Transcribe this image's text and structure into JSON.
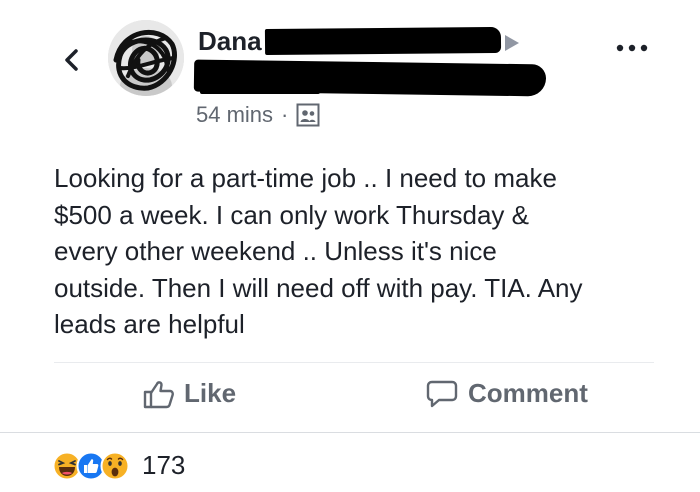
{
  "post": {
    "author_name_visible": "Dana",
    "timestamp": "54 mins",
    "separator": "·",
    "audience_icon": "friends-group-icon",
    "body": "Looking for a part-time job .. I need to make\n$500 a week. I can only work Thursday &\nevery other weekend .. Unless it's nice\noutside. Then I will need off with pay. TIA. Any\nleads are helpful"
  },
  "header": {
    "back_icon": "chevron-left-icon",
    "more_icon": "more-dots-icon"
  },
  "actions": {
    "like_label": "Like",
    "comment_label": "Comment"
  },
  "reactions": {
    "icons": [
      "haha-icon",
      "like-icon",
      "wow-icon"
    ],
    "count": "173"
  },
  "colors": {
    "text": "#1d2129",
    "secondary_text": "#616770",
    "like_blue": "#1877f2",
    "reaction_yellow": "#f7b125"
  }
}
